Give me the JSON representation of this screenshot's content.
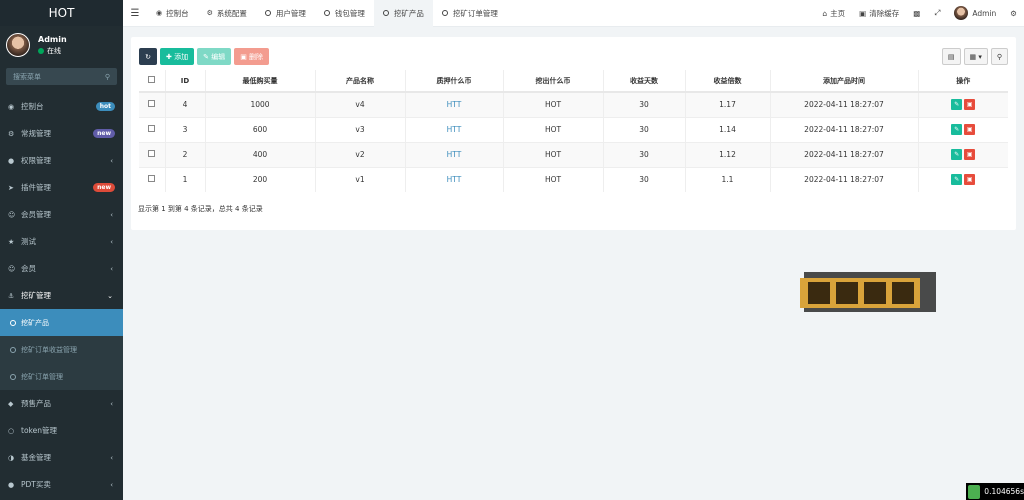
{
  "app": {
    "logo": "HOT"
  },
  "user": {
    "name": "Admin",
    "status": "在线"
  },
  "sidebar": {
    "search_placeholder": "搜索菜单",
    "items": [
      {
        "label": "控制台",
        "badge": "hot",
        "badge_color": "#3c8dbc"
      },
      {
        "label": "常规管理",
        "badge": "new",
        "badge_color": "#605ca8"
      },
      {
        "label": "权限管理"
      },
      {
        "label": "插件管理",
        "badge": "new",
        "badge_color": "#dd4b39"
      },
      {
        "label": "会员管理"
      },
      {
        "label": "测试"
      },
      {
        "label": "会员"
      },
      {
        "label": "挖矿管理"
      },
      {
        "label": "预售产品"
      },
      {
        "label": "token管理"
      },
      {
        "label": "基金管理"
      },
      {
        "label": "PDT买卖"
      }
    ],
    "sub_items": [
      {
        "label": "挖矿产品"
      },
      {
        "label": "挖矿订单收益管理"
      },
      {
        "label": "挖矿订单管理"
      }
    ]
  },
  "header": {
    "tabs": [
      {
        "label": "控制台"
      },
      {
        "label": "系统配置"
      },
      {
        "label": "用户管理"
      },
      {
        "label": "钱包管理"
      },
      {
        "label": "挖矿产品"
      },
      {
        "label": "挖矿订单管理"
      }
    ],
    "home": "主页",
    "clear_cache": "清除缓存",
    "admin": "Admin"
  },
  "toolbar": {
    "add": "添加",
    "edit": "编辑",
    "delete": "删除"
  },
  "table": {
    "headers": [
      "ID",
      "最低购买量",
      "产品名称",
      "质押什么币",
      "挖出什么币",
      "收益天数",
      "收益倍数",
      "添加产品时间",
      "操作"
    ],
    "rows": [
      [
        "4",
        "1000",
        "v4",
        "HTT",
        "HOT",
        "30",
        "1.17",
        "2022-04-11 18:27:07"
      ],
      [
        "3",
        "600",
        "v3",
        "HTT",
        "HOT",
        "30",
        "1.14",
        "2022-04-11 18:27:07"
      ],
      [
        "2",
        "400",
        "v2",
        "HTT",
        "HOT",
        "30",
        "1.12",
        "2022-04-11 18:27:07"
      ],
      [
        "1",
        "200",
        "v1",
        "HTT",
        "HOT",
        "30",
        "1.1",
        "2022-04-11 18:27:07"
      ]
    ]
  },
  "footer": "显示第 1 到第 4 条记录，总共 4 条记录",
  "timer": "0.104656s"
}
